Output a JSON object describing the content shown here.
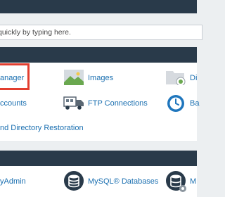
{
  "search": {
    "placeholder": "quickly by typing here."
  },
  "files": {
    "file_manager_label": "anager",
    "images_label": "Images",
    "directory_privacy_label": "Di",
    "ftp_accounts_label": "ccounts",
    "ftp_connections_label": "FTP Connections",
    "backup_label": "Ba",
    "restoration_label": "nd Directory Restoration"
  },
  "databases": {
    "phpmyadmin_label": "yAdmin",
    "mysql_databases_label": "MySQL® Databases",
    "wizard_label": "M"
  },
  "colors": {
    "header_bg": "#293a4a",
    "page_bg": "#eceff1",
    "link": "#1a6fb0",
    "highlight": "#e23e2f"
  }
}
